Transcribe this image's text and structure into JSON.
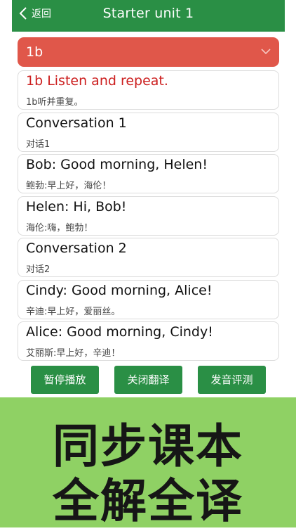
{
  "header": {
    "back_label": "返回",
    "title": "Starter unit 1"
  },
  "section_select": {
    "value": "1b"
  },
  "sentences": [
    {
      "en": "1b Listen and repeat.",
      "zh": "1b听并重复。",
      "active": true
    },
    {
      "en": "Conversation 1",
      "zh": "对话1"
    },
    {
      "en": "Bob: Good morning, Helen!",
      "zh": "鲍勃:早上好，海伦！"
    },
    {
      "en": "Helen: Hi, Bob!",
      "zh": "海伦:嗨，鲍勃！"
    },
    {
      "en": "Conversation 2",
      "zh": "对话2"
    },
    {
      "en": "Cindy: Good morning, Alice!",
      "zh": "辛迪:早上好，爱丽丝。"
    },
    {
      "en": "Alice: Good morning, Cindy!",
      "zh": "艾丽斯:早上好，辛迪！"
    }
  ],
  "controls": {
    "pause_label": "暂停播放",
    "translation_label": "关闭翻译",
    "pronunciation_label": "发音评测"
  },
  "banner": {
    "line1": "同步课本",
    "line2": "全解全译"
  },
  "colors": {
    "header_green": "#2a8f45",
    "select_red": "#e0574a",
    "active_text_red": "#cc1f1f",
    "banner_green": "#8fd164"
  }
}
